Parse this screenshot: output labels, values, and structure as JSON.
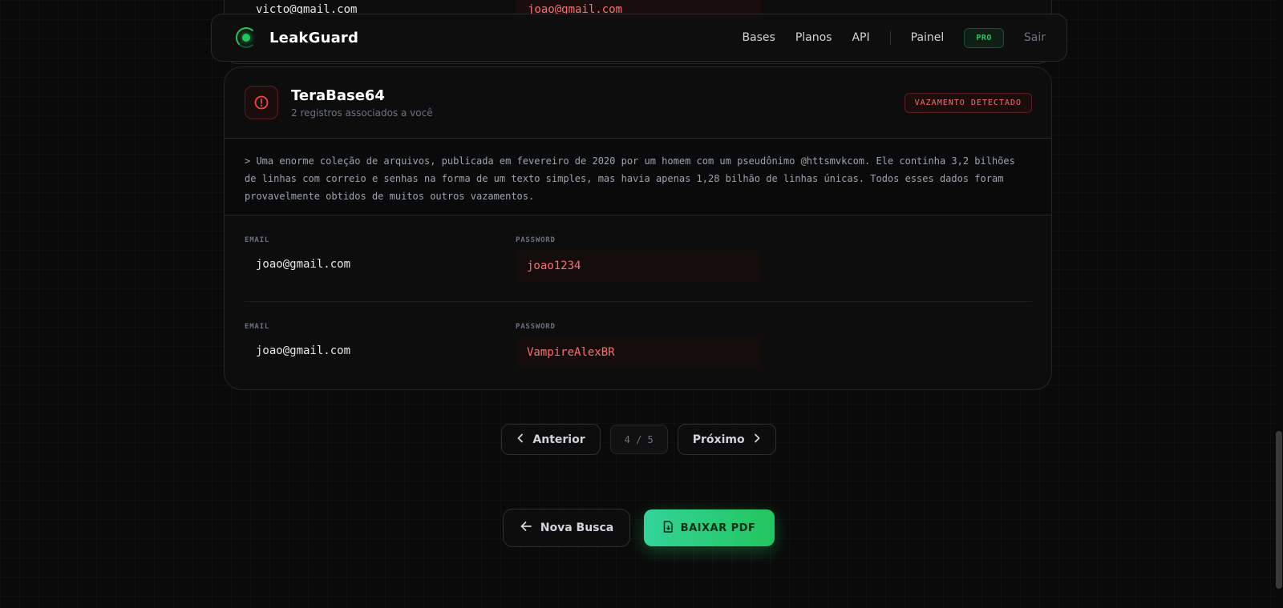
{
  "app": {
    "name": "LeakGuard"
  },
  "previous_record": {
    "email": "victo@gmail.com",
    "password": "joao@gmail.com"
  },
  "nav": {
    "links": [
      "Bases",
      "Planos",
      "API"
    ],
    "panel": "Painel",
    "badge": "PRO",
    "logout": "Sair"
  },
  "breach": {
    "name": "TeraBase64",
    "subtitle": "2 registros associados a você",
    "status": "VAZAMENTO DETECTADO",
    "description": "> Uma enorme coleção de arquivos, publicada em fevereiro de 2020 por um homem com um pseudônimo @httsmvkcom. Ele continha 3,2 bilhões de linhas com correio e senhas na forma de um texto simples, mas havia apenas 1,28 bilhão de linhas únicas. Todos esses dados foram provavelmente obtidos de muitos outros vazamentos.",
    "labels": {
      "email": "EMAIL",
      "password": "PASSWORD"
    },
    "records": [
      {
        "email": "joao@gmail.com",
        "password": "joao1234"
      },
      {
        "email": "joao@gmail.com",
        "password": "VampireAlexBR"
      }
    ]
  },
  "pagination": {
    "prev": "Anterior",
    "page": "4 / 5",
    "next": "Próximo"
  },
  "actions": {
    "new_search": "Nova Busca",
    "download_pdf": "BAIXAR PDF"
  },
  "colors": {
    "accent": "#22c55e",
    "danger": "#f87171",
    "background": "#0a0a0a"
  }
}
